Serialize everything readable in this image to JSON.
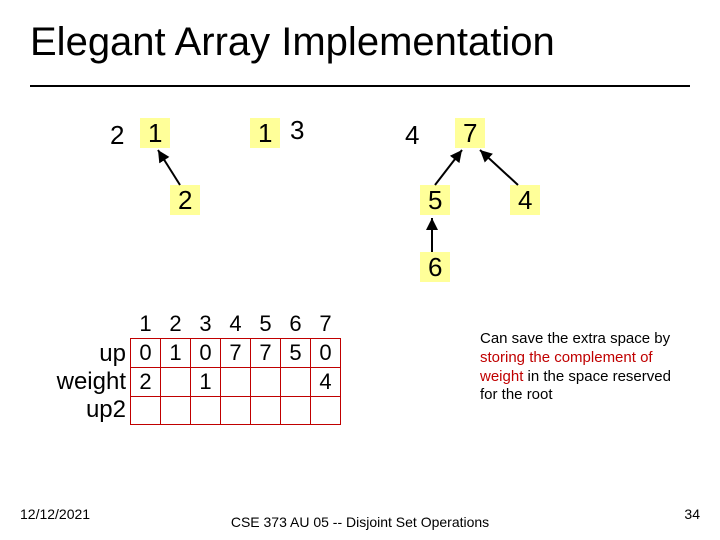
{
  "title": "Elegant Array Implementation",
  "trees": {
    "root1": {
      "label": "1",
      "weight_sup": "2",
      "child": "2"
    },
    "root2": {
      "label": "1",
      "weight_sup": "3"
    },
    "root3": {
      "label": "7",
      "weight_sup": "4",
      "child_left": "5",
      "child_right": "4",
      "grandchild": "6"
    }
  },
  "table": {
    "headers": [
      "1",
      "2",
      "3",
      "4",
      "5",
      "6",
      "7"
    ],
    "rows": [
      {
        "label": "up",
        "cells": [
          "0",
          "1",
          "0",
          "7",
          "7",
          "5",
          "0"
        ]
      },
      {
        "label": "weight",
        "cells": [
          "2",
          "",
          "1",
          "",
          "",
          "",
          "4"
        ]
      },
      {
        "label": "up2",
        "cells": [
          "",
          "",
          "",
          "",
          "",
          "",
          ""
        ]
      }
    ]
  },
  "sidenote": {
    "part1": "Can save the extra space by ",
    "hl1": "storing the complement of weight",
    "part2": " in the space reserved for the root"
  },
  "footer": {
    "date": "12/12/2021",
    "center": "CSE 373 AU 05 -- Disjoint Set Operations",
    "page": "34"
  }
}
